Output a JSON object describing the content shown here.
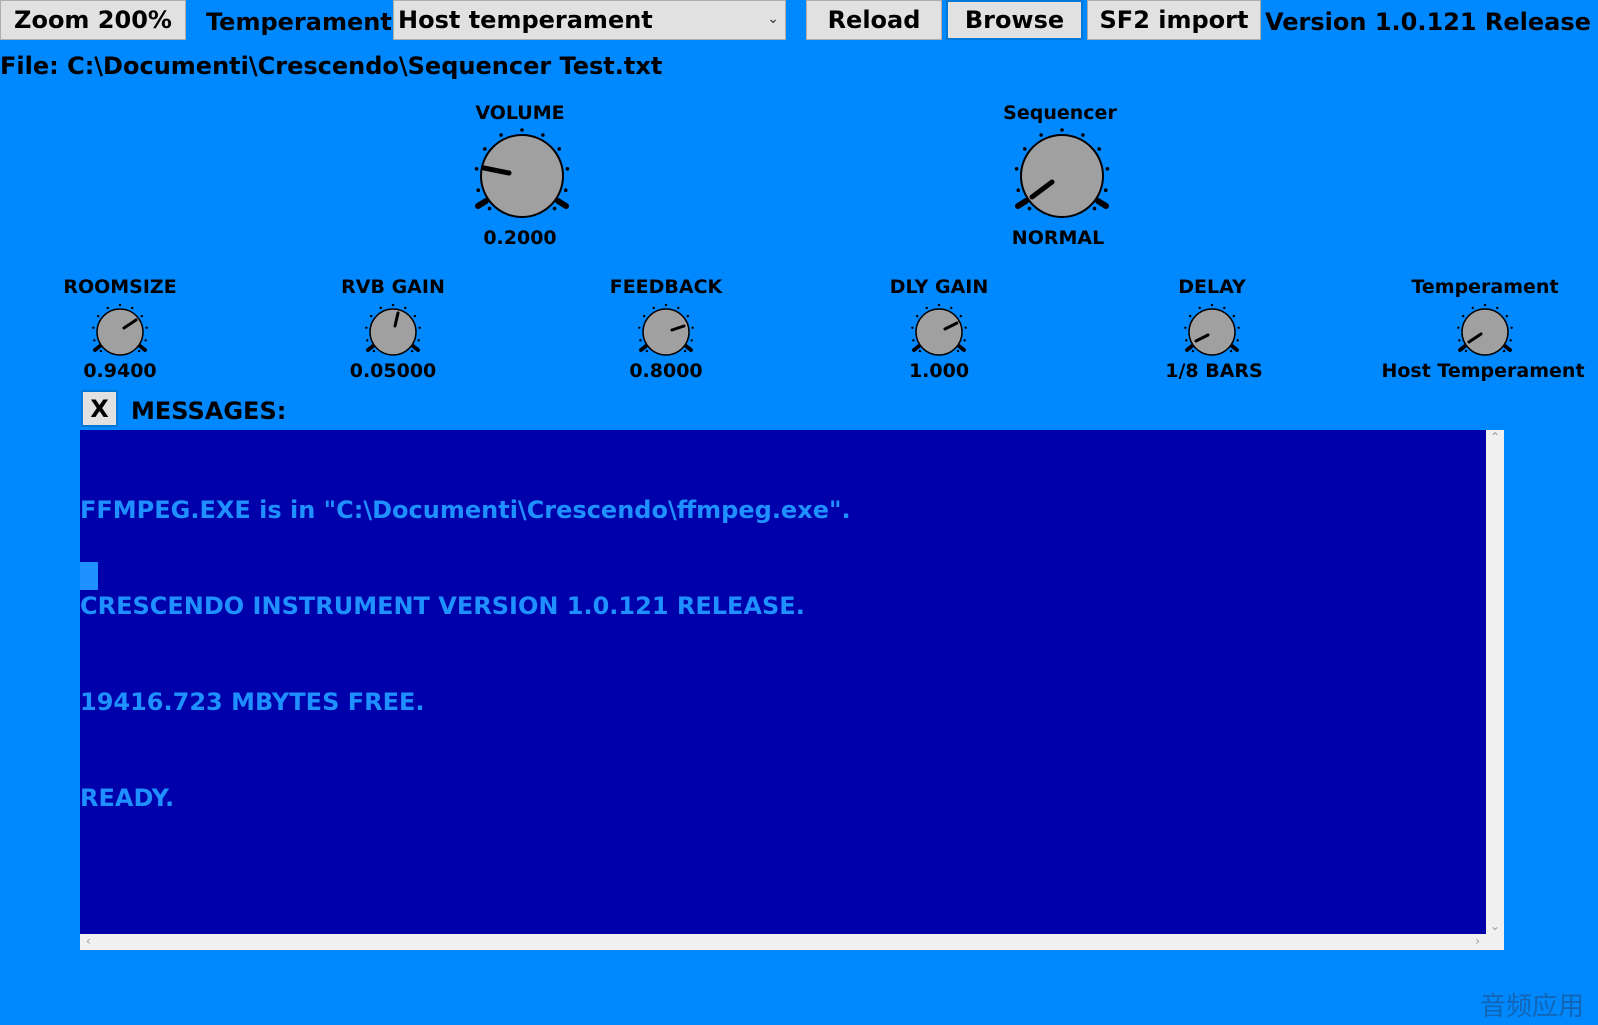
{
  "toolbar": {
    "zoom_label": "Zoom 200%",
    "temperament_label": "Temperament",
    "temperament_value": "Host temperament",
    "reload_label": "Reload",
    "browse_label": "Browse",
    "sf2_label": "SF2 import",
    "version_text": "Version 1.0.121 Release"
  },
  "file_text": "File: C:\\Documenti\\Crescendo\\Sequencer Test.txt",
  "big_knobs": [
    {
      "label": "VOLUME",
      "value": "0.2000"
    },
    {
      "label": "Sequencer",
      "value": "NORMAL"
    }
  ],
  "small_knobs": [
    {
      "label": "ROOMSIZE",
      "value": "0.9400"
    },
    {
      "label": "RVB GAIN",
      "value": "0.05000"
    },
    {
      "label": "FEEDBACK",
      "value": "0.8000"
    },
    {
      "label": "DLY GAIN",
      "value": "1.000"
    },
    {
      "label": "DELAY",
      "value": "1/8 BARS"
    },
    {
      "label": "Temperament",
      "value": "Host Temperament"
    }
  ],
  "messages": {
    "close_label": "X",
    "title": "MESSAGES:",
    "lines": [
      "FFMPEG.EXE is in \"C:\\Documenti\\Crescendo\\ffmpeg.exe\".",
      "CRESCENDO INSTRUMENT VERSION 1.0.121 RELEASE.",
      "19416.723 MBYTES FREE.",
      "READY."
    ]
  },
  "watermark": "音频应用",
  "colors": {
    "background": "#0088ff",
    "console_bg": "#0000aa",
    "console_text": "#1e90ff",
    "knob_fill": "#a0a0a0"
  },
  "icons": {
    "dropdown": "chevron-down-icon",
    "scroll_up": "scroll-up-icon",
    "scroll_down": "scroll-down-icon",
    "scroll_left": "scroll-left-icon",
    "scroll_right": "scroll-right-icon"
  }
}
